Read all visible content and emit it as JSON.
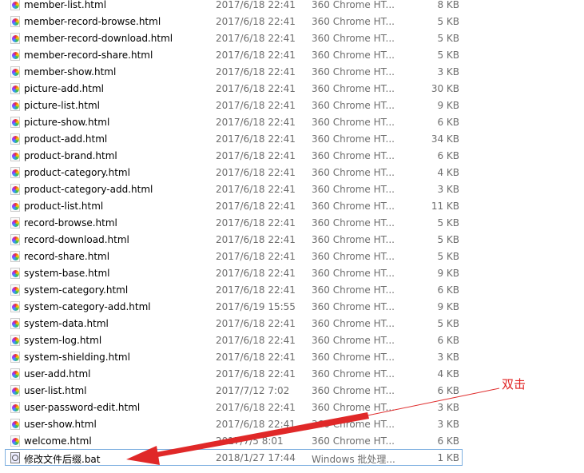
{
  "files": [
    {
      "name": "member-list.html",
      "date": "2017/6/18 22:41",
      "type": "360 Chrome HT...",
      "size": "8 KB",
      "icon": "chrome-html-icon"
    },
    {
      "name": "member-record-browse.html",
      "date": "2017/6/18 22:41",
      "type": "360 Chrome HT...",
      "size": "5 KB",
      "icon": "chrome-html-icon"
    },
    {
      "name": "member-record-download.html",
      "date": "2017/6/18 22:41",
      "type": "360 Chrome HT...",
      "size": "5 KB",
      "icon": "chrome-html-icon"
    },
    {
      "name": "member-record-share.html",
      "date": "2017/6/18 22:41",
      "type": "360 Chrome HT...",
      "size": "5 KB",
      "icon": "chrome-html-icon"
    },
    {
      "name": "member-show.html",
      "date": "2017/6/18 22:41",
      "type": "360 Chrome HT...",
      "size": "3 KB",
      "icon": "chrome-html-icon"
    },
    {
      "name": "picture-add.html",
      "date": "2017/6/18 22:41",
      "type": "360 Chrome HT...",
      "size": "30 KB",
      "icon": "chrome-html-icon"
    },
    {
      "name": "picture-list.html",
      "date": "2017/6/18 22:41",
      "type": "360 Chrome HT...",
      "size": "9 KB",
      "icon": "chrome-html-icon"
    },
    {
      "name": "picture-show.html",
      "date": "2017/6/18 22:41",
      "type": "360 Chrome HT...",
      "size": "6 KB",
      "icon": "chrome-html-icon"
    },
    {
      "name": "product-add.html",
      "date": "2017/6/18 22:41",
      "type": "360 Chrome HT...",
      "size": "34 KB",
      "icon": "chrome-html-icon"
    },
    {
      "name": "product-brand.html",
      "date": "2017/6/18 22:41",
      "type": "360 Chrome HT...",
      "size": "6 KB",
      "icon": "chrome-html-icon"
    },
    {
      "name": "product-category.html",
      "date": "2017/6/18 22:41",
      "type": "360 Chrome HT...",
      "size": "4 KB",
      "icon": "chrome-html-icon"
    },
    {
      "name": "product-category-add.html",
      "date": "2017/6/18 22:41",
      "type": "360 Chrome HT...",
      "size": "3 KB",
      "icon": "chrome-html-icon"
    },
    {
      "name": "product-list.html",
      "date": "2017/6/18 22:41",
      "type": "360 Chrome HT...",
      "size": "11 KB",
      "icon": "chrome-html-icon"
    },
    {
      "name": "record-browse.html",
      "date": "2017/6/18 22:41",
      "type": "360 Chrome HT...",
      "size": "5 KB",
      "icon": "chrome-html-icon"
    },
    {
      "name": "record-download.html",
      "date": "2017/6/18 22:41",
      "type": "360 Chrome HT...",
      "size": "5 KB",
      "icon": "chrome-html-icon"
    },
    {
      "name": "record-share.html",
      "date": "2017/6/18 22:41",
      "type": "360 Chrome HT...",
      "size": "5 KB",
      "icon": "chrome-html-icon"
    },
    {
      "name": "system-base.html",
      "date": "2017/6/18 22:41",
      "type": "360 Chrome HT...",
      "size": "9 KB",
      "icon": "chrome-html-icon"
    },
    {
      "name": "system-category.html",
      "date": "2017/6/18 22:41",
      "type": "360 Chrome HT...",
      "size": "6 KB",
      "icon": "chrome-html-icon"
    },
    {
      "name": "system-category-add.html",
      "date": "2017/6/19 15:55",
      "type": "360 Chrome HT...",
      "size": "9 KB",
      "icon": "chrome-html-icon"
    },
    {
      "name": "system-data.html",
      "date": "2017/6/18 22:41",
      "type": "360 Chrome HT...",
      "size": "5 KB",
      "icon": "chrome-html-icon"
    },
    {
      "name": "system-log.html",
      "date": "2017/6/18 22:41",
      "type": "360 Chrome HT...",
      "size": "6 KB",
      "icon": "chrome-html-icon"
    },
    {
      "name": "system-shielding.html",
      "date": "2017/6/18 22:41",
      "type": "360 Chrome HT...",
      "size": "3 KB",
      "icon": "chrome-html-icon"
    },
    {
      "name": "user-add.html",
      "date": "2017/6/18 22:41",
      "type": "360 Chrome HT...",
      "size": "4 KB",
      "icon": "chrome-html-icon"
    },
    {
      "name": "user-list.html",
      "date": "2017/7/12 7:02",
      "type": "360 Chrome HT...",
      "size": "6 KB",
      "icon": "chrome-html-icon"
    },
    {
      "name": "user-password-edit.html",
      "date": "2017/6/18 22:41",
      "type": "360 Chrome HT...",
      "size": "3 KB",
      "icon": "chrome-html-icon"
    },
    {
      "name": "user-show.html",
      "date": "2017/6/18 22:41",
      "type": "360 Chrome HT...",
      "size": "3 KB",
      "icon": "chrome-html-icon"
    },
    {
      "name": "welcome.html",
      "date": "2017/7/5 8:01",
      "type": "360 Chrome HT...",
      "size": "6 KB",
      "icon": "chrome-html-icon"
    },
    {
      "name": "修改文件后缀.bat",
      "date": "2018/1/27 17:44",
      "type": "Windows 批处理...",
      "size": "1 KB",
      "icon": "batch-file-icon",
      "selected": true
    }
  ],
  "annotation": {
    "text": "双击",
    "color": "#e02020"
  }
}
